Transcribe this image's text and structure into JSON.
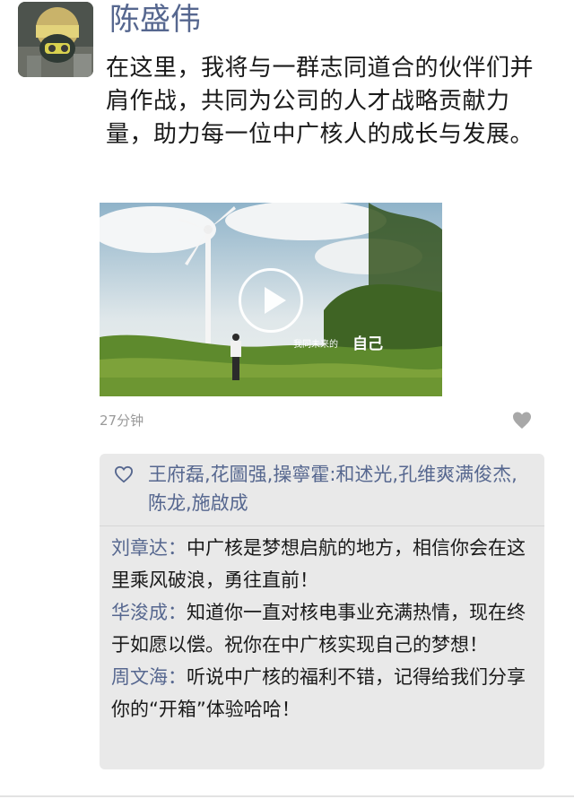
{
  "post": {
    "author": "陈盛伟",
    "text": "在这里，我将与一群志同道合的伙伴们并肩作战，共同为公司的人才战略贡献力量，助力每一位中广核人的成长与发展。",
    "video": {
      "caption_small": "我同未来的",
      "caption_large": "自己"
    },
    "timestamp": "27分钟"
  },
  "likes": {
    "names": "王府磊,花圖强,操寧霍:和述光,孔维爽满俊杰,陈龙,施啟成"
  },
  "comments": [
    {
      "author": "刘章达",
      "separator": "：",
      "text": "中广核是梦想启航的地方，相信你会在这里乘风破浪，勇往直前！"
    },
    {
      "author": "华浚成",
      "separator": "：",
      "text": "知道你一直对核电事业充满热情，现在终于如愿以偿。祝你在中广核实现自己的梦想！"
    },
    {
      "author": "周文海",
      "separator": "：",
      "text": "听说中广核的福利不错，记得给我们分享你的“开箱”体验哈哈！"
    }
  ],
  "colors": {
    "link": "#56678f",
    "comment_bg": "#e9e9e9",
    "text": "#1a1a1a",
    "meta": "#9a9a9a"
  },
  "icons": {
    "likes": "heart-outline-icon",
    "more": "heart-filled-icon",
    "video": "play-icon"
  }
}
